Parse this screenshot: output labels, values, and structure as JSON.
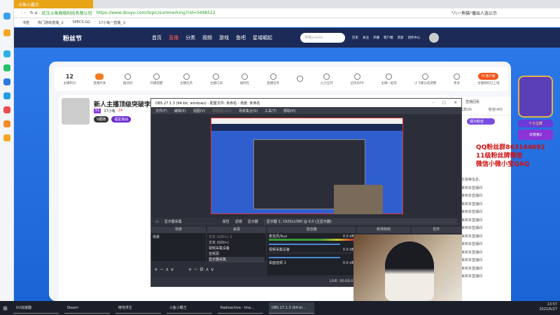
{
  "browser": {
    "tab_title": "斗鱼小霸王",
    "site_name": "武汉斗鱼网络科技有限公司",
    "url": "https://www.douyu.com/topic/summerking?rid=5498522",
    "search_hint": "\"八一熊猫\"播出人选公示",
    "bookmarks": [
      "书签",
      "热门游戏直播_斗",
      "SPECS.GG",
      "17小龟一直播_斗"
    ]
  },
  "header": {
    "logo": "粉丝节",
    "nav": [
      "首页",
      "直播",
      "分类",
      "视频",
      "游戏",
      "鱼吧",
      "星域崛起"
    ],
    "search_placeholder": "搜索praste",
    "icons": [
      "历史",
      "关注",
      "开播",
      "客户端",
      "消息",
      "创作中心"
    ]
  },
  "toolbar": {
    "score": "12",
    "score_label": "主播积分",
    "items": [
      "直播开关",
      "推流码",
      "开播提醒",
      "主播任务",
      "主播口袋",
      "福利社",
      "直播任务",
      "",
      "火力全开",
      "全民乐PK",
      "主播一起玩",
      "小飞碟分成调整",
      "更多"
    ],
    "pc_client": "PC客户端",
    "pc_note": "主播授权已上线"
  },
  "streamer": {
    "title": "新人主播顶级突破李狗",
    "level": "51",
    "name": "17小龟",
    "hot": "24",
    "v_tag": "V跟随",
    "fans_tag": "福星挑战"
  },
  "obs": {
    "title": "OBS 27.1.3 (64-bit, windows) - 配置文件: 未命名 - 场景: 未命名",
    "menu": [
      "文件(F)",
      "编辑(E)",
      "视图(V)",
      "停靠窗口(D)",
      "场景集合(S)",
      "工具(T)",
      "帮助(H)"
    ],
    "source_bar": "显示器采集",
    "props": "属性",
    "filters": "滤镜",
    "display_label": "显示器",
    "display_value": "显示器 1: 1920x1080 @ 0,0 (主显示器)",
    "docks": [
      "场景",
      "来源",
      "混音器",
      "转场特效",
      "控件"
    ],
    "scene": "场景",
    "sources": [
      "文本 (GDI+) 2",
      "文本 (GDI+)",
      "视频采集设备",
      "音频源",
      "显示器采集"
    ],
    "mixer": [
      {
        "name": "麦克风/Aux",
        "db": "0.0 dB"
      },
      {
        "name": "视频采集设备",
        "db": "0.0 dB"
      },
      {
        "name": "桌面音频 2",
        "db": "0.0 dB"
      }
    ],
    "status": "LIVE: 00:00:0"
  },
  "chat": {
    "replay": "直播回看",
    "tabs": [
      "贵宾(8)",
      "粉丝(40)"
    ],
    "become_fan": "成为粉丝",
    "notice": "以下交易等信息。",
    "messages": [
      "欢迎来到本直播间",
      "欢迎来到本直播间",
      "欢迎来到本直播间",
      "欢迎来到本直播间",
      "欢迎来到本直播间",
      "欢迎来到本直播间",
      "欢迎来到本直播间",
      "欢迎来到本直播间",
      "欢迎来到本直播间",
      "欢迎来到本直播间",
      "欢迎来到本直播间",
      "欢迎来到本直播间"
    ]
  },
  "overlay": [
    "QQ粉丝群863144092",
    "11级粉丝牌微信",
    "微信小微小宝QAQ"
  ],
  "side": {
    "badge": "十大宝藏",
    "rank": "日榜第2"
  },
  "taskbar": {
    "apps": [
      "UU加速器",
      "Steam",
      "绝地求生",
      "斗鱼小霸王",
      "Radioactive - Ima...",
      "OBS 27.1.3 (64-bi..."
    ],
    "time": "13:57",
    "date": "2022/6/27"
  }
}
